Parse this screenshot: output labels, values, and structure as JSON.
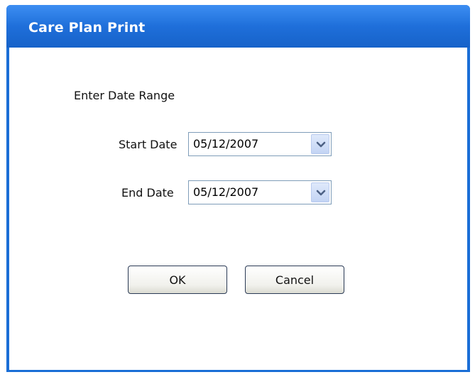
{
  "window": {
    "title": "Care Plan Print"
  },
  "form": {
    "heading": "Enter Date Range",
    "start_date": {
      "label": "Start Date",
      "value": "05/12/2007"
    },
    "end_date": {
      "label": "End Date",
      "value": "05/12/2007"
    }
  },
  "buttons": {
    "ok_label": "OK",
    "cancel_label": "Cancel"
  },
  "icons": {
    "dropdown": "chevron-down-icon"
  },
  "colors": {
    "titlebar": "#1f6fda",
    "title_text": "#ffffff",
    "combo_border": "#7f9db9",
    "chevron": "#4d6185"
  }
}
